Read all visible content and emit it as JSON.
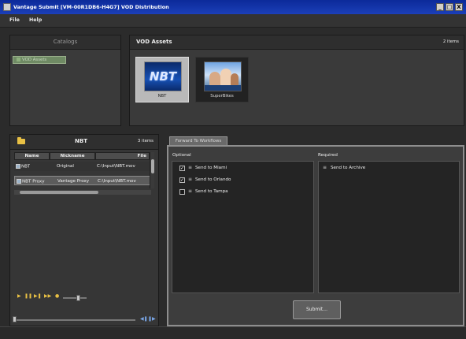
{
  "window": {
    "title": "Vantage Submit [VM-00R1DB6-H4G7] VOD Distribution",
    "controls": {
      "minimize": "_",
      "maximize": "□",
      "close": "X"
    }
  },
  "menu": {
    "file": "File",
    "help": "Help"
  },
  "catalogs": {
    "title": "Catalogs",
    "items": [
      {
        "label": "VOD Assets"
      }
    ]
  },
  "assets": {
    "title": "VOD Assets",
    "count": "2 items",
    "items": [
      {
        "label": "NBT",
        "thumb_text": "NBT",
        "selected": true
      },
      {
        "label": "SuperBikes",
        "selected": false
      }
    ]
  },
  "details": {
    "title": "NBT",
    "count": "3 items",
    "columns": [
      "Name",
      "Nickname",
      "File"
    ],
    "rows": [
      {
        "name": "NBT",
        "nickname": "Original",
        "file": "C:\\Input\\NBT.mov"
      },
      {
        "name": "NBT Proxy",
        "nickname": "Vantage Proxy",
        "file": "C:\\Input\\NBT.mov"
      }
    ]
  },
  "player": {
    "play_icon": "play-icon",
    "stop_icon": "stop-icon",
    "volume_icon": "speaker-icon",
    "volume_level": 0.55,
    "position": 0.0
  },
  "workflows": {
    "tab_label": "Forward To Workflows",
    "optional_label": "Optional",
    "required_label": "Required",
    "optional": [
      {
        "label": "Send to Miami",
        "checked": true
      },
      {
        "label": "Send to Orlando",
        "checked": true
      },
      {
        "label": "Send to Tampa",
        "checked": false
      }
    ],
    "required": [
      {
        "label": "Send to Archive"
      }
    ],
    "submit_label": "Submit..."
  },
  "colors": {
    "title_bar": "#1b3fb8",
    "panel_bg": "#3a3a3a",
    "selected_tile": "#b9b9b9",
    "catalog_item": "#6f8a64"
  }
}
